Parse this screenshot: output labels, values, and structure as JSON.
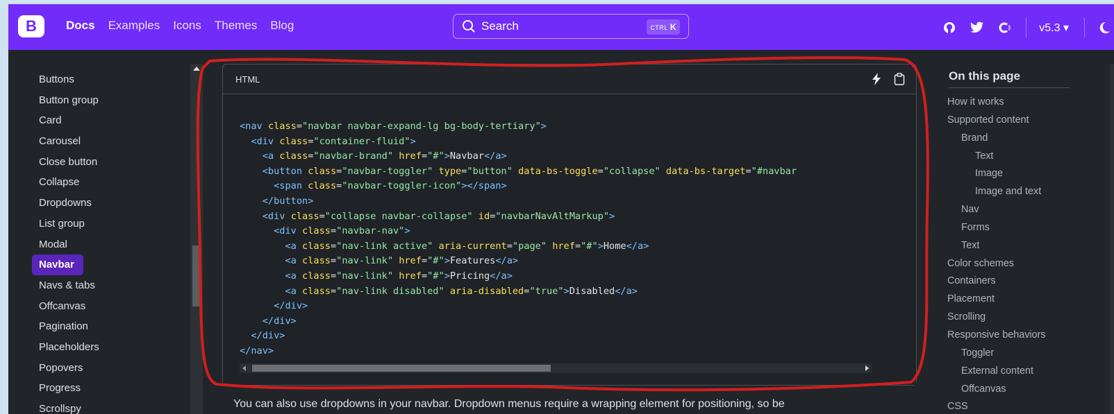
{
  "navbar": {
    "logo_letter": "B",
    "links": [
      "Docs",
      "Examples",
      "Icons",
      "Themes",
      "Blog"
    ],
    "search_label": "Search",
    "search_shortcut_ctrl": "CTRL",
    "search_shortcut_key": "K",
    "version": "v5.3 ▾",
    "brand_color": "#712cf9"
  },
  "sidebar": {
    "items": [
      "Buttons",
      "Button group",
      "Card",
      "Carousel",
      "Close button",
      "Collapse",
      "Dropdowns",
      "List group",
      "Modal",
      "Navbar",
      "Navs & tabs",
      "Offcanvas",
      "Pagination",
      "Placeholders",
      "Popovers",
      "Progress",
      "Scrollspy"
    ],
    "active": "Navbar"
  },
  "code": {
    "language_label": "HTML",
    "lines": [
      "<nav class=\"navbar navbar-expand-lg bg-body-tertiary\">",
      "  <div class=\"container-fluid\">",
      "    <a class=\"navbar-brand\" href=\"#\">Navbar</a>",
      "    <button class=\"navbar-toggler\" type=\"button\" data-bs-toggle=\"collapse\" data-bs-target=\"#navbar",
      "      <span class=\"navbar-toggler-icon\"></span>",
      "    </button>",
      "    <div class=\"collapse navbar-collapse\" id=\"navbarNavAltMarkup\">",
      "      <div class=\"navbar-nav\">",
      "        <a class=\"nav-link active\" aria-current=\"page\" href=\"#\">Home</a>",
      "        <a class=\"nav-link\" href=\"#\">Features</a>",
      "        <a class=\"nav-link\" href=\"#\">Pricing</a>",
      "        <a class=\"nav-link disabled\" aria-disabled=\"true\">Disabled</a>",
      "      </div>",
      "    </div>",
      "  </div>",
      "</nav>"
    ]
  },
  "body_text": "You can also use dropdowns in your navbar. Dropdown menus require a wrapping element for positioning, so be",
  "toc": {
    "title": "On this page",
    "items": [
      {
        "label": "How it works",
        "level": 1
      },
      {
        "label": "Supported content",
        "level": 1
      },
      {
        "label": "Brand",
        "level": 2
      },
      {
        "label": "Text",
        "level": 3
      },
      {
        "label": "Image",
        "level": 3
      },
      {
        "label": "Image and text",
        "level": 3
      },
      {
        "label": "Nav",
        "level": 2
      },
      {
        "label": "Forms",
        "level": 2
      },
      {
        "label": "Text",
        "level": 2
      },
      {
        "label": "Color schemes",
        "level": 1
      },
      {
        "label": "Containers",
        "level": 1
      },
      {
        "label": "Placement",
        "level": 1
      },
      {
        "label": "Scrolling",
        "level": 1
      },
      {
        "label": "Responsive behaviors",
        "level": 1
      },
      {
        "label": "Toggler",
        "level": 2
      },
      {
        "label": "External content",
        "level": 2
      },
      {
        "label": "Offcanvas",
        "level": 2
      },
      {
        "label": "CSS",
        "level": 1
      }
    ]
  },
  "icons": {
    "top_right": [
      "github-icon",
      "twitter-icon",
      "opencollective-icon",
      "theme-toggle-icon"
    ],
    "code_actions": [
      "stackblitz-icon",
      "clipboard-icon"
    ]
  },
  "annotation_color": "#d11f1f"
}
